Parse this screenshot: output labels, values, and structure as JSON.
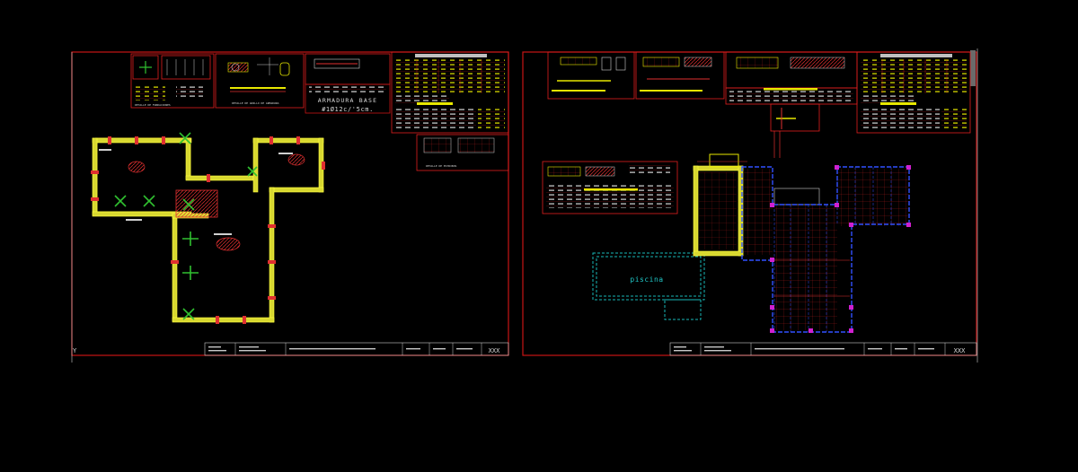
{
  "colors": {
    "background": "#000000",
    "frame": "#c81414",
    "red_lines": "#e02020",
    "wall_yellow": "#e8e800",
    "pier_green": "#30c030",
    "pool_cyan": "#18b8b8",
    "slab_blue": "#3050ff",
    "column_magenta": "#d020d0",
    "text_white": "#d0d0d0"
  },
  "left_sheet": {
    "armadura_title": "ARMADURA BASE",
    "armadura_spec": "#1Ø12c/'5cm.",
    "sheet_code": "XXX",
    "axis_marker": "Y"
  },
  "right_sheet": {
    "pool_label": "piscina",
    "sheet_code": "XXX"
  },
  "icons": {
    "ucs_icon": "axis-icon"
  }
}
